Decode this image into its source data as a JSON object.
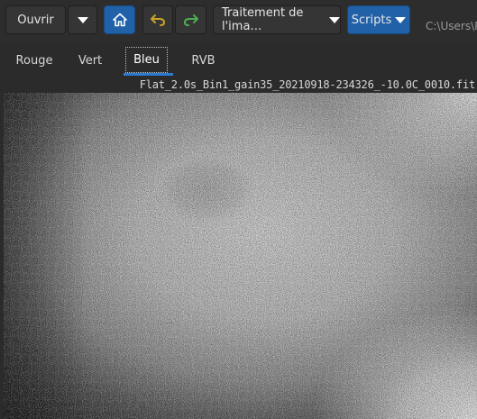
{
  "toolbar": {
    "open_label": "Ouvrir",
    "processing_label": "Traitement de l'ima…",
    "scripts_label": "Scripts",
    "path": "C:\\Users\\P",
    "icons": {
      "dropdown": "chevron-down-icon",
      "home": "home-icon",
      "undo": "undo-icon",
      "redo": "redo-icon"
    }
  },
  "tabs": {
    "items": [
      {
        "label": "Rouge"
      },
      {
        "label": "Vert"
      },
      {
        "label": "Bleu",
        "selected": true
      },
      {
        "label": "RVB"
      }
    ]
  },
  "image": {
    "filename": "Flat_2.0s_Bin1_gain35_20210918-234326_-10.0C_0010.fit"
  },
  "colors": {
    "accent": "#2161a8",
    "tab_underline": "#2d7bd1",
    "undo_arrow": "#c9a227",
    "redo_arrow": "#4caf50"
  }
}
